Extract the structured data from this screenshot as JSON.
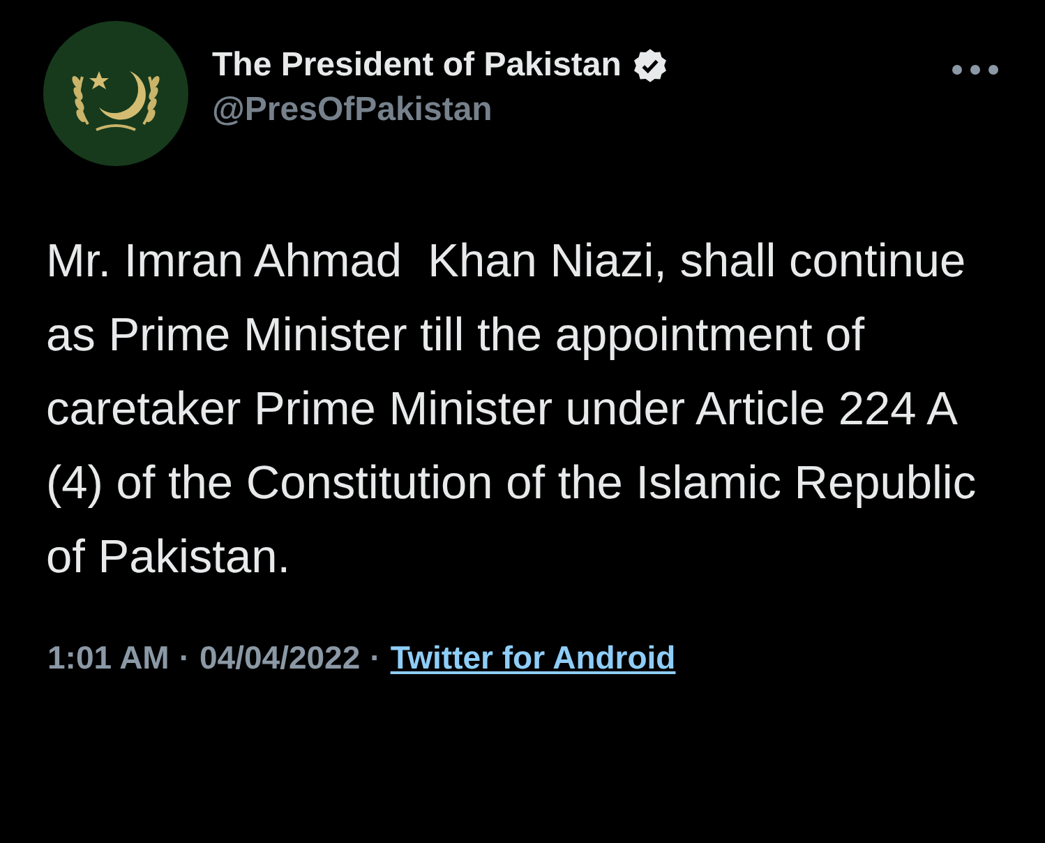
{
  "author": {
    "name": "The President of Pakistan",
    "verified": true,
    "handle": "@PresOfPakistan"
  },
  "body": "Mr. Imran Ahmad  Khan Niazi, shall continue as Prime Minister till the appointment of caretaker Prime Minister under Article 224 A (4) of the Constitution of the Islamic Republic of Pakistan.",
  "meta": [
    {
      "kind": "text",
      "text": "1:01 AM"
    },
    {
      "kind": "separator",
      "text": "·"
    },
    {
      "kind": "text",
      "text": "04/04/2022"
    },
    {
      "kind": "separator",
      "text": "·"
    },
    {
      "kind": "link",
      "text": "Twitter for Android"
    }
  ]
}
